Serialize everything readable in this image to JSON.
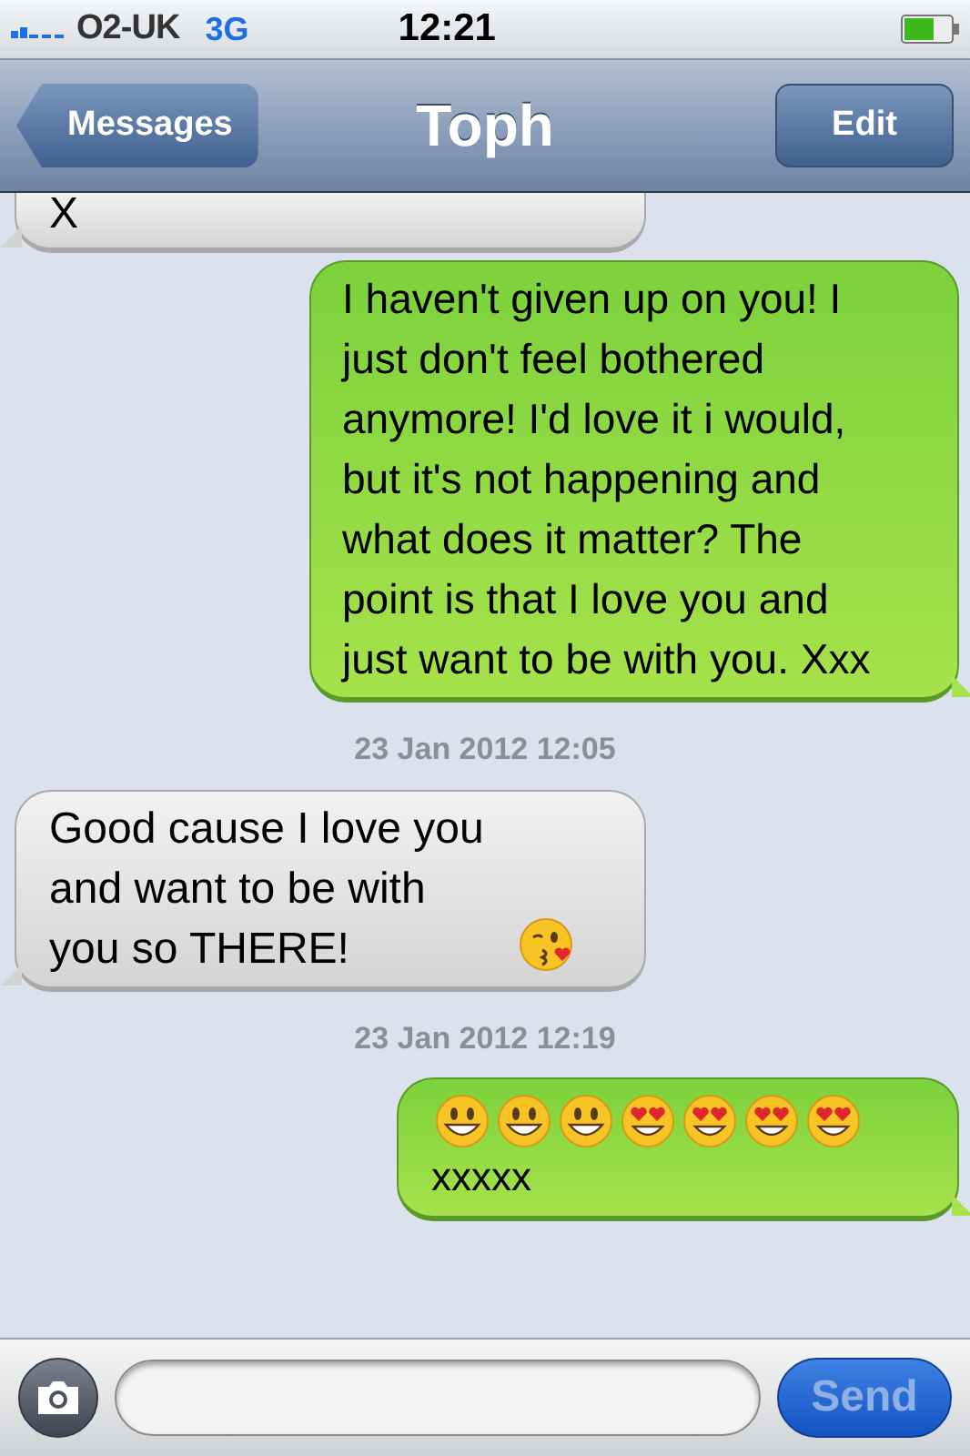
{
  "status_bar": {
    "carrier": "O2-UK",
    "network": "3G",
    "time": "12:21"
  },
  "nav": {
    "back": "Messages",
    "title": "Toph",
    "action": "Edit"
  },
  "messages": [
    {
      "kind": "bubble",
      "from_me": false,
      "text": "X"
    },
    {
      "kind": "bubble",
      "from_me": true,
      "text": "I haven't given up on you! I just don't feel bothered anymore! I'd love it i would, but it's not happening and what does it matter? The point is that I love you and just want to be with you. Xxx"
    },
    {
      "kind": "timestamp",
      "text": "23 Jan 2012 12:05"
    },
    {
      "kind": "bubble",
      "from_me": false,
      "text": "Good cause I love you and want to be with you so THERE!",
      "emojis": [
        {
          "kind": "kiss"
        }
      ]
    },
    {
      "kind": "timestamp",
      "text": "23 Jan 2012 12:19"
    },
    {
      "kind": "bubble",
      "from_me": true,
      "text": "xxxxx",
      "emojis": [
        {
          "kind": "grin"
        },
        {
          "kind": "grin"
        },
        {
          "kind": "grin"
        },
        {
          "kind": "hearts"
        },
        {
          "kind": "hearts"
        },
        {
          "kind": "hearts"
        },
        {
          "kind": "hearts"
        }
      ]
    }
  ],
  "compose": {
    "send": "Send",
    "send_disabled": true
  }
}
